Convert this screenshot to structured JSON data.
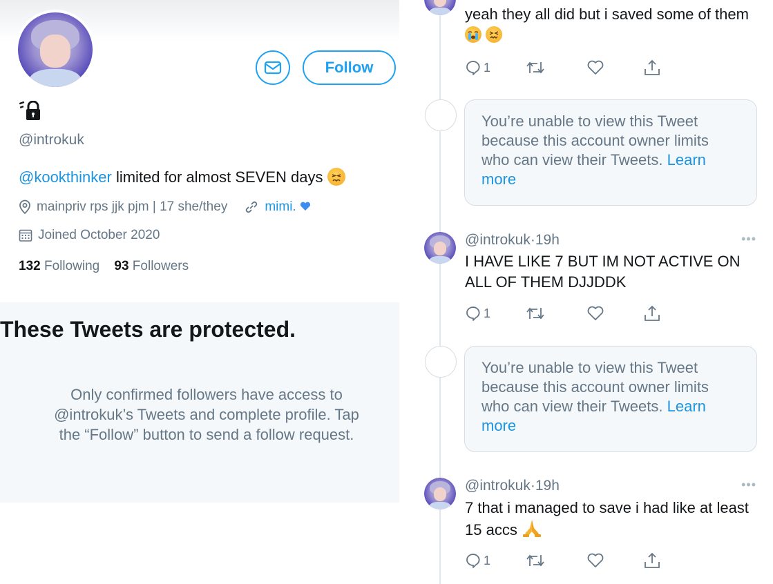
{
  "profile": {
    "follow_label": "Follow",
    "handle": "@introkuk",
    "bio_mention": "@kookthinker",
    "bio_text": " limited for almost SEVEN days",
    "location": "mainpriv rps jjk pjm | 17 she/they",
    "link_text": "mimi.",
    "joined": "Joined October 2020",
    "following_count": "132",
    "following_label": "Following",
    "followers_count": "93",
    "followers_label": "Followers"
  },
  "protected": {
    "title": "These Tweets are protected.",
    "body": "Only confirmed followers have access to @introkuk’s Tweets and complete profile. Tap the “Follow” button to send a follow request."
  },
  "thread": {
    "top_tweet_text": "yeah they all did but i saved some of them",
    "unavailable_text": "You’re unable to view this Tweet because this account owner limits who can view their Tweets. ",
    "learn_more": "Learn more",
    "tweets": [
      {
        "handle": "@introkuk",
        "time": "19h",
        "text": "I HAVE LIKE 7 BUT IM NOT ACTIVE ON ALL OF THEM DJJDDK",
        "reply_count": "1"
      },
      {
        "handle": "@introkuk",
        "time": "19h",
        "text": "7 that i managed to save i had like at least 15 accs",
        "reply_count": "1"
      }
    ],
    "top_reply_count": "1",
    "more_glyph": "•••",
    "separator": "·"
  },
  "colors": {
    "accent": "#1da1f2",
    "link": "#1b95e0",
    "secondary_text": "#657786",
    "panel_bg": "#f5f8fa"
  },
  "icons": [
    "mail-icon",
    "lock-icon",
    "location-icon",
    "link-icon",
    "calendar-icon",
    "reply-icon",
    "retweet-icon",
    "like-icon",
    "share-icon",
    "more-icon"
  ]
}
